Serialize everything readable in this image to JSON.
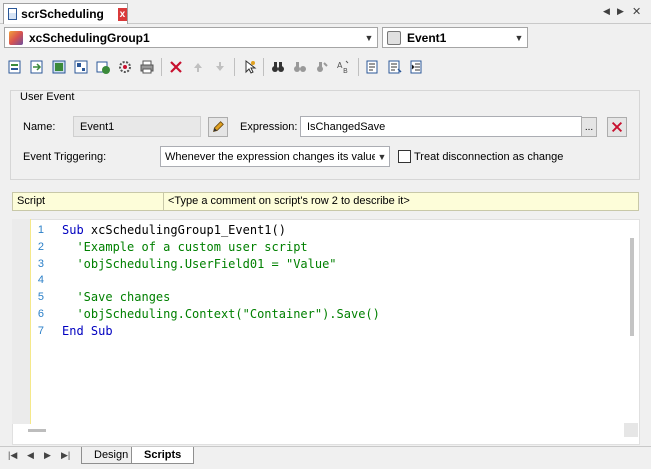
{
  "window": {
    "tab_title": "scrScheduling",
    "close_glyph": "x",
    "scroll_left_glyph": "◀",
    "scroll_right_glyph": "▶",
    "close_panel_glyph": "✕"
  },
  "selectors": {
    "object": "xcSchedulingGroup1",
    "event": "Event1",
    "dropdown_glyph": "▼"
  },
  "toolbar": {
    "icons": [
      "new-script-icon",
      "import-icon",
      "export-icon",
      "properties-icon",
      "run-icon",
      "settings-icon",
      "print-icon",
      "delete-icon",
      "move-up-icon",
      "move-down-icon",
      "pick-tag-icon",
      "find-icon",
      "find-next-icon",
      "replace-icon",
      "spellcheck-icon",
      "comment-icon",
      "uncomment-icon",
      "indent-icon"
    ]
  },
  "user_event": {
    "group_title": "User Event",
    "name_label": "Name:",
    "name_value": "Event1",
    "expression_label": "Expression:",
    "expression_value": "IsChangedSave",
    "browse_label": "...",
    "triggering_label": "Event Triggering:",
    "triggering_value": "Whenever the expression changes its value",
    "disconnection_label": "Treat disconnection as change",
    "disconnection_checked": false
  },
  "comment_bar": {
    "col1": "Script",
    "col2": "<Type a comment on script's row 2 to describe it>"
  },
  "editor": {
    "lines": [
      {
        "n": "1",
        "text": "Sub xcSchedulingGroup1_Event1()"
      },
      {
        "n": "2",
        "text": "  'Example of a custom user script"
      },
      {
        "n": "3",
        "text": "  'objScheduling.UserField01 = \"Value\""
      },
      {
        "n": "4",
        "text": ""
      },
      {
        "n": "5",
        "text": "  'Save changes"
      },
      {
        "n": "6",
        "text": "  'objScheduling.Context(\"Container\").Save()"
      },
      {
        "n": "7",
        "text": "End Sub"
      }
    ]
  },
  "bottom_tabs": {
    "nav": [
      "|◀",
      "◀",
      "▶",
      "▶|"
    ],
    "design": "Design",
    "scripts": "Scripts"
  },
  "colors": {
    "keyword": "#0000c0",
    "comment": "#008000",
    "line_number": "#2a7fc8",
    "comment_bar_bg": "#fdfdd9",
    "delete_red": "#c8102e"
  }
}
